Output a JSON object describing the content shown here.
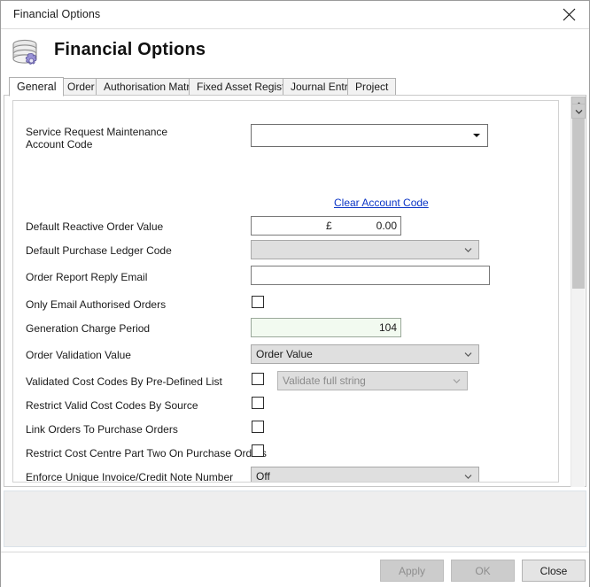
{
  "window": {
    "title": "Financial Options",
    "close_icon": "close-icon"
  },
  "header": {
    "title": "Financial Options",
    "icon": "coins-database-gear-icon"
  },
  "tabs": [
    {
      "label": "General",
      "active": true
    },
    {
      "label": "Order",
      "active": false
    },
    {
      "label": "Authorisation Matrix",
      "active": false
    },
    {
      "label": "Fixed Asset Register",
      "active": false
    },
    {
      "label": "Journal Entry",
      "active": false
    },
    {
      "label": "Project",
      "active": false
    }
  ],
  "form": {
    "service_request_account_code": {
      "label_line1": "Service Request Maintenance",
      "label_line2": "Account Code",
      "value": ""
    },
    "clear_account_code_link": "Clear Account Code",
    "default_reactive_order_value": {
      "label": "Default Reactive Order Value",
      "currency": "£",
      "value": "0.00"
    },
    "default_purchase_ledger_code": {
      "label": "Default Purchase Ledger Code",
      "value": ""
    },
    "order_report_reply_email": {
      "label": "Order Report Reply Email",
      "value": ""
    },
    "only_email_authorised_orders": {
      "label": "Only Email Authorised Orders",
      "checked": false
    },
    "generation_charge_period": {
      "label": "Generation Charge Period",
      "value": "104"
    },
    "order_validation_value": {
      "label": "Order Validation Value",
      "value": "Order Value"
    },
    "validated_cost_codes": {
      "label": "Validated Cost Codes By Pre-Defined List",
      "checked": false,
      "dropdown_value": "Validate full string"
    },
    "restrict_valid_cost_codes": {
      "label": "Restrict Valid Cost Codes By Source",
      "checked": false
    },
    "link_orders_to_purchase_orders": {
      "label": "Link Orders To Purchase Orders",
      "checked": false
    },
    "restrict_cost_centre_part_two": {
      "label": "Restrict Cost Centre Part Two On Purchase Orders",
      "checked": false
    },
    "enforce_unique_invoice": {
      "label": "Enforce Unique Invoice/Credit Note Number",
      "value": "Off"
    }
  },
  "footer": {
    "apply": "Apply",
    "ok": "OK",
    "close": "Close"
  }
}
